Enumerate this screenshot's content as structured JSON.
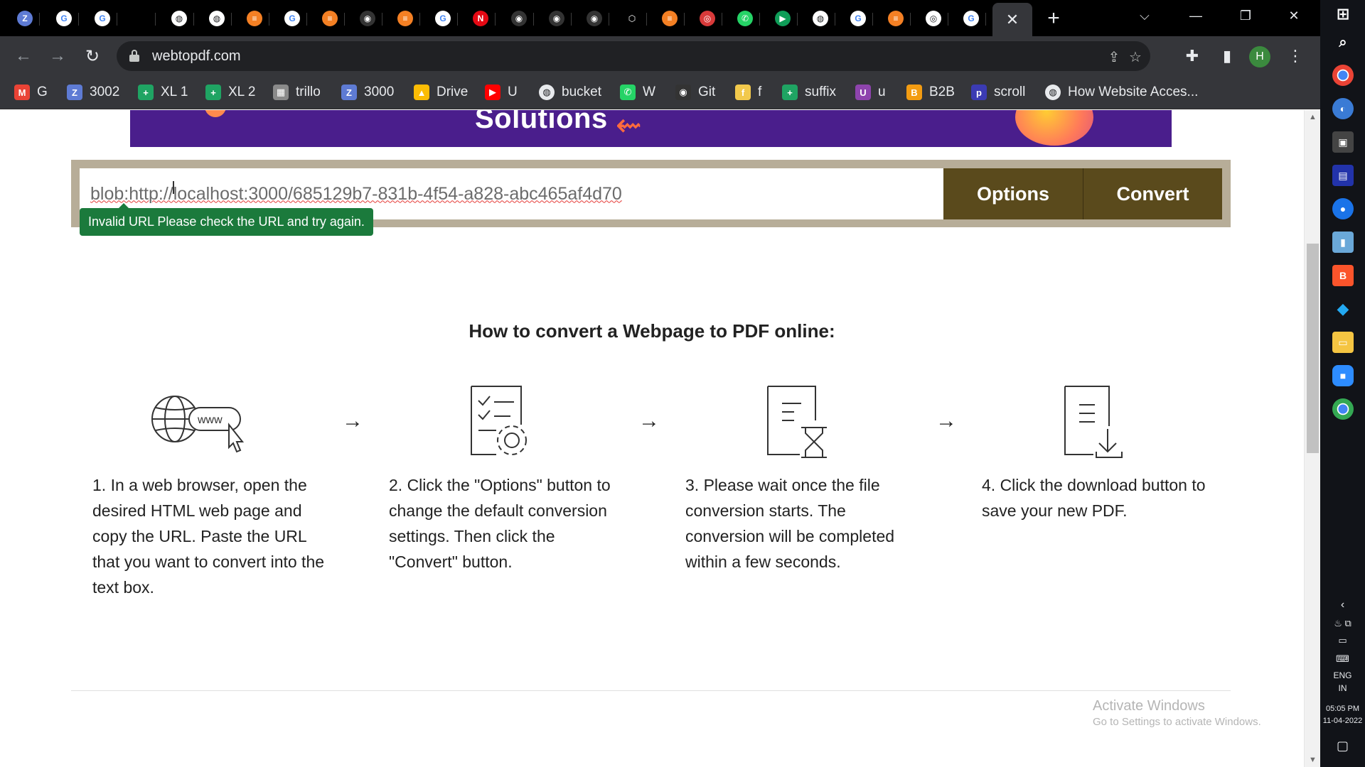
{
  "browser": {
    "tabs": [
      {
        "icon": "bracket-icon",
        "color": "#5e7bd4",
        "glyph": "Z"
      },
      {
        "icon": "google-icon",
        "color": "#ffffff",
        "glyph": "G"
      },
      {
        "icon": "google-icon",
        "color": "#ffffff",
        "glyph": "G"
      },
      {
        "icon": "blank-icon",
        "color": "#000000",
        "glyph": ""
      },
      {
        "icon": "globe-icon",
        "color": "#ffffff",
        "glyph": "◍"
      },
      {
        "icon": "globe-icon",
        "color": "#d0d0d0",
        "glyph": "◍"
      },
      {
        "icon": "stackoverflow-icon",
        "color": "#f48024",
        "glyph": "≡"
      },
      {
        "icon": "google-icon",
        "color": "#ffffff",
        "glyph": "G"
      },
      {
        "icon": "stackoverflow-icon",
        "color": "#f48024",
        "glyph": "≡"
      },
      {
        "icon": "github-icon",
        "color": "#333333",
        "glyph": "◉"
      },
      {
        "icon": "stackoverflow-icon",
        "color": "#f48024",
        "glyph": "≡"
      },
      {
        "icon": "google-icon",
        "color": "#ffffff",
        "glyph": "G"
      },
      {
        "icon": "netflix-icon",
        "color": "#e50914",
        "glyph": "N"
      },
      {
        "icon": "github-icon",
        "color": "#333333",
        "glyph": "◉"
      },
      {
        "icon": "github-icon",
        "color": "#333333",
        "glyph": "◉"
      },
      {
        "icon": "github-icon",
        "color": "#333333",
        "glyph": "◉"
      },
      {
        "icon": "codesandbox-icon",
        "color": "#000000",
        "glyph": "⬡"
      },
      {
        "icon": "stackoverflow-icon",
        "color": "#f48024",
        "glyph": "≡"
      },
      {
        "icon": "redux-icon",
        "color": "#d83a3a",
        "glyph": "◎"
      },
      {
        "icon": "whatsapp-icon",
        "color": "#25d366",
        "glyph": "✆"
      },
      {
        "icon": "meet-icon",
        "color": "#0f9d58",
        "glyph": "▶"
      },
      {
        "icon": "globe-icon",
        "color": "#ffffff",
        "glyph": "◍"
      },
      {
        "icon": "google-icon",
        "color": "#ffffff",
        "glyph": "G"
      },
      {
        "icon": "stackoverflow-icon",
        "color": "#f48024",
        "glyph": "≡"
      },
      {
        "icon": "chrome-icon",
        "color": "#ffffff",
        "glyph": "◎"
      },
      {
        "icon": "google-icon",
        "color": "#ffffff",
        "glyph": "G"
      }
    ],
    "url": "webtopdf.com",
    "bookmarks": [
      {
        "label": "G",
        "icon": "gmail-icon",
        "color": "#ea4335",
        "glyph": "M"
      },
      {
        "label": "3002",
        "icon": "bracket-icon",
        "color": "#5e7bd4",
        "glyph": "Z"
      },
      {
        "label": "XL 1",
        "icon": "sheets-icon",
        "color": "#1fa463",
        "glyph": "+"
      },
      {
        "label": "XL 2",
        "icon": "sheets-icon",
        "color": "#1fa463",
        "glyph": "+"
      },
      {
        "label": "trillo",
        "icon": "trillo-icon",
        "color": "#8a8a8a",
        "glyph": "▦"
      },
      {
        "label": "3000",
        "icon": "bracket-icon",
        "color": "#5e7bd4",
        "glyph": "Z"
      },
      {
        "label": "Drive",
        "icon": "drive-icon",
        "color": "#fbbc04",
        "glyph": "▲"
      },
      {
        "label": "U",
        "icon": "youtube-icon",
        "color": "#ff0000",
        "glyph": "▶"
      },
      {
        "label": "bucket",
        "icon": "globe-icon",
        "color": "#e8eaed",
        "glyph": "◍"
      },
      {
        "label": "W",
        "icon": "whatsapp-icon",
        "color": "#25d366",
        "glyph": "✆"
      },
      {
        "label": "Git",
        "icon": "github-icon",
        "color": "#333333",
        "glyph": "◉"
      },
      {
        "label": "f",
        "icon": "figma-icon",
        "color": "#f2c94c",
        "glyph": "f"
      },
      {
        "label": "suffix",
        "icon": "sheets-icon",
        "color": "#1fa463",
        "glyph": "+"
      },
      {
        "label": "u",
        "icon": "upwork-icon",
        "color": "#8e44ad",
        "glyph": "U"
      },
      {
        "label": "B2B",
        "icon": "b2b-icon",
        "color": "#f39c12",
        "glyph": "B"
      },
      {
        "label": "scroll",
        "icon": "scroll-icon",
        "color": "#3b3bb3",
        "glyph": "p"
      },
      {
        "label": "How Website Acces...",
        "icon": "globe-icon",
        "color": "#e8eaed",
        "glyph": "◍"
      }
    ],
    "profile_initial": "H"
  },
  "page": {
    "banner_text": "Solutions",
    "converter": {
      "input_value": "blob:http://localhost:3000/685129b7-831b-4f54-a828-abc465af4d70",
      "options_label": "Options",
      "convert_label": "Convert",
      "error_tooltip": "Invalid URL Please check the URL and try again."
    },
    "howto_title": "How to convert a Webpage to PDF online:",
    "steps": [
      {
        "icon": "globe-www-click-icon",
        "text": "1. In a web browser, open the desired HTML web page and copy the URL. Paste the URL that you want to convert into the text box."
      },
      {
        "icon": "document-settings-icon",
        "text": "2. Click the \"Options\" button to change the default conversion settings. Then click the \"Convert\" button."
      },
      {
        "icon": "document-hourglass-icon",
        "text": "3. Please wait once the file conversion starts. The conversion will be completed within a few seconds."
      },
      {
        "icon": "document-download-icon",
        "text": "4. Click the download button to save your new PDF."
      }
    ],
    "watermark": {
      "line1": "Activate Windows",
      "line2": "Go to Settings to activate Windows."
    }
  },
  "taskbar": {
    "language_line1": "ENG",
    "language_line2": "IN",
    "time": "05:05 PM",
    "date": "11-04-2022"
  },
  "colors": {
    "converter_button": "#5a4a1c",
    "converter_frame": "#b7ad98",
    "tooltip_green": "#1b7a3c",
    "banner_purple": "#4a1e8c"
  }
}
